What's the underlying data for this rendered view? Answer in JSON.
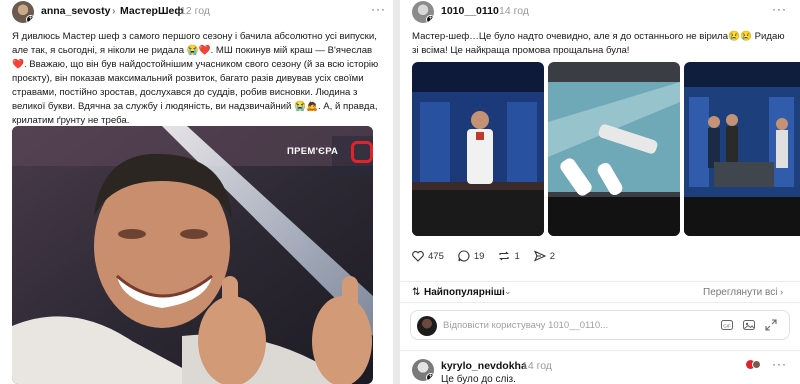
{
  "left_post": {
    "username": "anna_sevosty",
    "separator": "›",
    "topic": "МастерШеф",
    "time": "12 год",
    "more": "···",
    "text": "Я дивлюсь Мастер шеф з самого першого сезону і бачила абсолютно усі випуски, але так, я сьогодні, я ніколи не ридала 😭❤️. МШ покинув мій краш — В'ячеслав❤️. Вважаю, що він був найдостойнішим учасником свого сезону (й за всю історію проєкту), він показав максимальний розвиток, багато разів дивував усіх своїми стравами, постійно зростав, дослухався до суддів, робив висновки. Людина з великої букви. Вдячна за службу і людяність, ви надзвичайний 😭🙇. А, й правда, крилатим ґрунту не треба.",
    "photo": {
      "watermark": "ПРЕМ'ЄРА",
      "description_icon": "laughing-chef-photo"
    }
  },
  "right_post": {
    "username": "1010__0110",
    "time": "14 год",
    "more": "···",
    "text": "Мастер-шеф…Це було надто очевидно, але я до останнього не вірила😢😢 Ридаю зі всіма! Це найкраща промова прощальна була!",
    "photos": [
      {
        "name": "studio-chef-photo"
      },
      {
        "name": "knives-photo"
      },
      {
        "name": "judges-photo"
      }
    ],
    "actions": {
      "likes": "475",
      "comments": "19",
      "reposts": "1",
      "shares": "2"
    },
    "sort": {
      "label": "Найпопулярніші",
      "view_all": "Переглянути всі"
    },
    "reply": {
      "placeholder": "Відповісти користувачу 1010__0110..."
    },
    "comment": {
      "username": "kyrylo_nevdokha",
      "time": "14 год",
      "text": "Це було до сліз."
    }
  },
  "colors": {
    "accent_red": "#e0242b",
    "muted_text": "#9a9a9a",
    "card_bg": "#ffffff",
    "page_bg": "#e9e9e9"
  }
}
